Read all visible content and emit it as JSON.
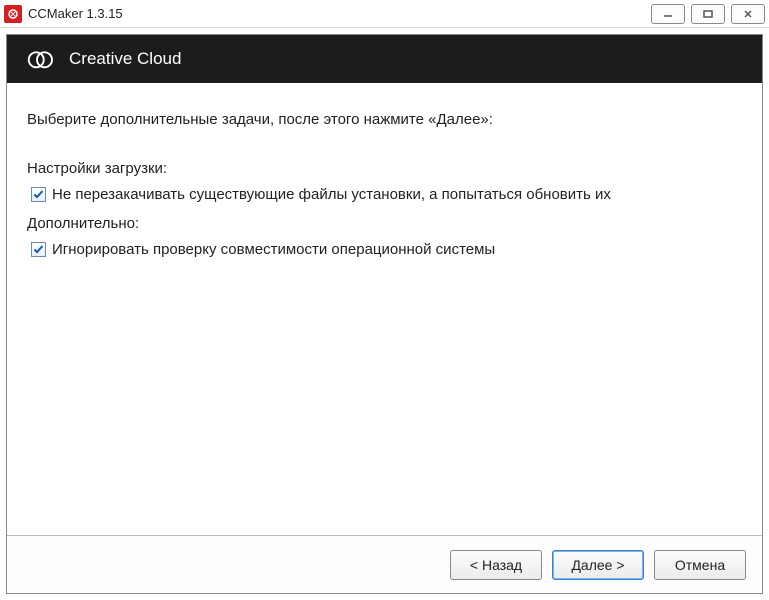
{
  "titlebar": {
    "title": "CCMaker 1.3.15"
  },
  "header": {
    "title": "Creative Cloud"
  },
  "content": {
    "instruction": "Выберите дополнительные задачи, после этого нажмите «Далее»:",
    "section1_label": "Настройки загрузки:",
    "check1_label": "Не перезакачивать существующие файлы установки, а попытаться обновить их",
    "section2_label": "Дополнительно:",
    "check2_label": "Игнорировать проверку совместимости операционной системы"
  },
  "footer": {
    "back": "< Назад",
    "next": "Далее >",
    "cancel": "Отмена"
  }
}
